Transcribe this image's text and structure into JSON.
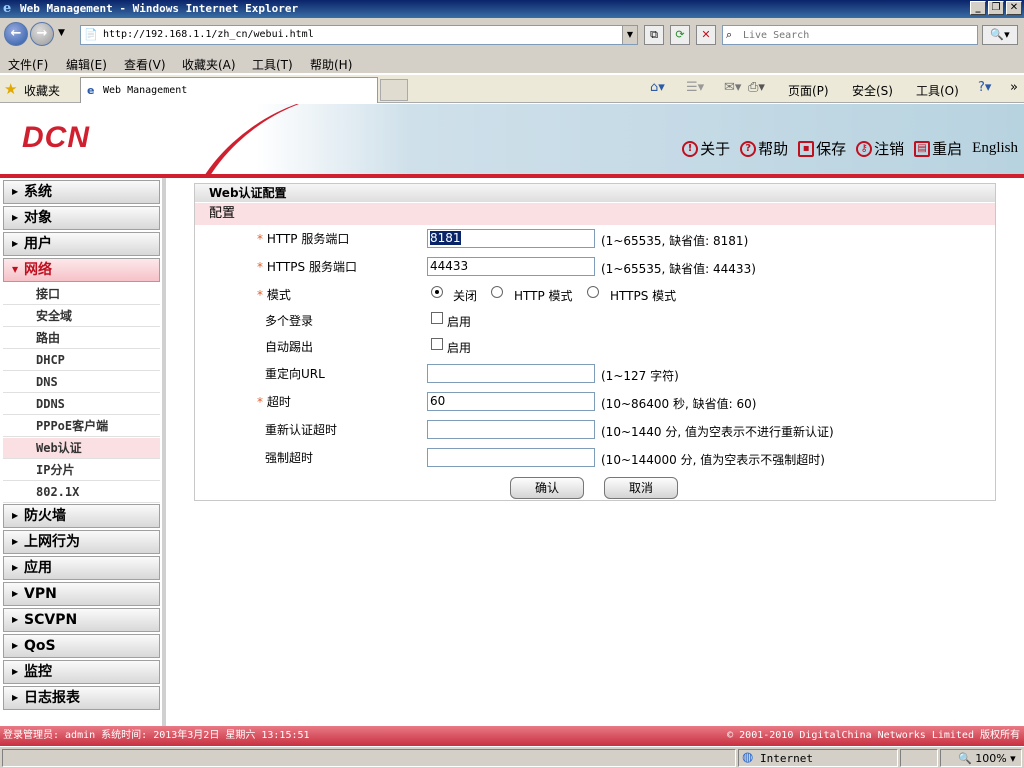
{
  "window": {
    "title": "Web Management - Windows Internet Explorer"
  },
  "address": {
    "url": "http://192.168.1.1/zh_cn/webui.html",
    "search_placeholder": "Live Search"
  },
  "menubar": [
    "文件(F)",
    "编辑(E)",
    "查看(V)",
    "收藏夹(A)",
    "工具(T)",
    "帮助(H)"
  ],
  "favbar": {
    "favorites": "收藏夹",
    "tab_title": "Web Management"
  },
  "commandbar": {
    "page": "页面(P)",
    "safety": "安全(S)",
    "tools": "工具(O)"
  },
  "header": {
    "logo": "DCN",
    "links": {
      "about": "关于",
      "help": "帮助",
      "save": "保存",
      "logout": "注销",
      "reboot": "重启",
      "lang": "English"
    }
  },
  "sidebar": {
    "top": [
      "系统",
      "对象",
      "用户"
    ],
    "network": "网络",
    "network_sub": [
      "接口",
      "安全域",
      "路由",
      "DHCP",
      "DNS",
      "DDNS",
      "PPPoE客户端",
      "Web认证",
      "IP分片",
      "802.1X"
    ],
    "bottom": [
      "防火墙",
      "上网行为",
      "应用",
      "VPN",
      "SCVPN",
      "QoS",
      "监控",
      "日志报表"
    ]
  },
  "panel": {
    "title": "Web认证配置",
    "section": "配置",
    "http_port": {
      "label": "HTTP 服务端口",
      "value": "8181",
      "hint": "(1~65535, 缺省值: 8181)"
    },
    "https_port": {
      "label": "HTTPS 服务端口",
      "value": "44433",
      "hint": "(1~65535, 缺省值: 44433)"
    },
    "mode": {
      "label": "模式",
      "options": [
        "关闭",
        "HTTP 模式",
        "HTTPS 模式"
      ],
      "selected": "关闭"
    },
    "multi_login": {
      "label": "多个登录",
      "check_label": "启用",
      "checked": false
    },
    "auto_kick": {
      "label": "自动踢出",
      "check_label": "启用",
      "checked": false
    },
    "redirect_url": {
      "label": "重定向URL",
      "value": "",
      "hint": "(1~127 字符)"
    },
    "timeout": {
      "label": "超时",
      "value": "60",
      "hint": "(10~86400 秒, 缺省值: 60)"
    },
    "reauth_timeout": {
      "label": "重新认证超时",
      "value": "",
      "hint": "(10~1440 分, 值为空表示不进行重新认证)"
    },
    "force_timeout": {
      "label": "强制超时",
      "value": "",
      "hint": "(10~144000 分, 值为空表示不强制超时)"
    },
    "ok_button": "确认",
    "cancel_button": "取消"
  },
  "status": {
    "left": "登录管理员: admin 系统时间: 2013年3月2日 星期六 13:15:51",
    "right": "© 2001-2010 DigitalChina Networks Limited 版权所有",
    "zone": "Internet",
    "zoom": "100%"
  },
  "colors": {
    "brand_red": "#d02030",
    "selection_pink": "#fbe0e3"
  }
}
